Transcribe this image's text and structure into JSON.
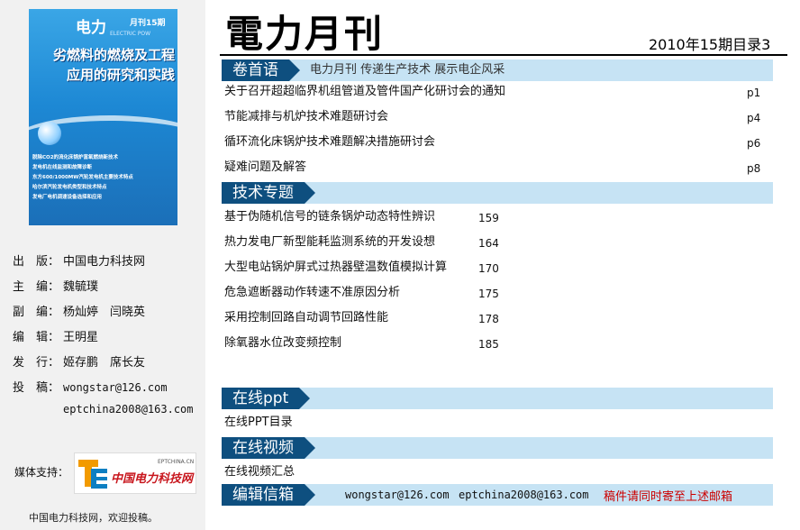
{
  "cover": {
    "brand": "电力",
    "issue": "月刊15期",
    "subtitle": "ELECTRIC POW",
    "headline_1": "劣燃料的燃烧及工程",
    "headline_2": "应用的研究和实践",
    "lines": [
      "脱除CO2的流化床锅炉富氧燃烧新技术",
      "发电机在线监测和故障诊断",
      "东方600/1000MW汽轮发电机主要技术特点",
      "哈尔滨汽轮发电机类型和技术特点",
      "发电厂电机调速设备选择和应用"
    ]
  },
  "info": [
    {
      "label": "出　版：",
      "value": "中国电力科技网"
    },
    {
      "label": "主　编：",
      "value": "魏毓璞"
    },
    {
      "label": "副　编：",
      "value": "杨灿婷　闫晓英"
    },
    {
      "label": "编　辑：",
      "value": "王明星"
    },
    {
      "label": "发　行：",
      "value": "姬存鹏　席长友"
    },
    {
      "label": "投　稿：",
      "value": "wongstar@126.com"
    }
  ],
  "info_extra_email": "eptchina2008@163.com",
  "media": {
    "label": "媒体支持：",
    "logo_text": "中国电力科技网",
    "logo_small": "EPTCHINA.CN"
  },
  "footer_note": "中国电力科技网，欢迎投稿。",
  "header": {
    "title": "電力月刊",
    "issue": "2010年15期目录3"
  },
  "sections": {
    "preface": {
      "title": "卷首语",
      "slogan": "电力月刊  传递生产技术   展示电企风采",
      "items": [
        {
          "title": "关于召开超超临界机组管道及管件国产化研讨会的通知",
          "page": "p1"
        },
        {
          "title": "节能减排与机炉技术难题研讨会",
          "page": "p4"
        },
        {
          "title": "循环流化床锅炉技术难题解决措施研讨会",
          "page": "p6"
        },
        {
          "title": "疑难问题及解答",
          "page": "p8"
        }
      ]
    },
    "tech": {
      "title": "技术专题",
      "items": [
        {
          "title": "基于伪随机信号的链条锅炉动态特性辨识",
          "page": "159"
        },
        {
          "title": "热力发电厂新型能耗监测系统的开发设想",
          "page": "164"
        },
        {
          "title": "大型电站锅炉屏式过热器壁温数值模拟计算",
          "page": "170"
        },
        {
          "title": "危急遮断器动作转速不准原因分析",
          "page": "175"
        },
        {
          "title": "采用控制回路自动调节回路性能",
          "page": "178"
        },
        {
          "title": "除氧器水位改变频控制",
          "page": "185"
        }
      ]
    },
    "ppt": {
      "title": "在线ppt",
      "item": "在线PPT目录"
    },
    "video": {
      "title": "在线视频",
      "item": "在线视频汇总"
    },
    "contact": {
      "title": "编辑信箱",
      "email_1": "wongstar@126.com",
      "email_2": "eptchina2008@163.com",
      "note": "稿件请同时寄至上述邮箱"
    }
  },
  "colors": {
    "tag_bg": "#0e4f7f",
    "band_bg": "#c6e3f4",
    "note_red": "#cc0000"
  }
}
